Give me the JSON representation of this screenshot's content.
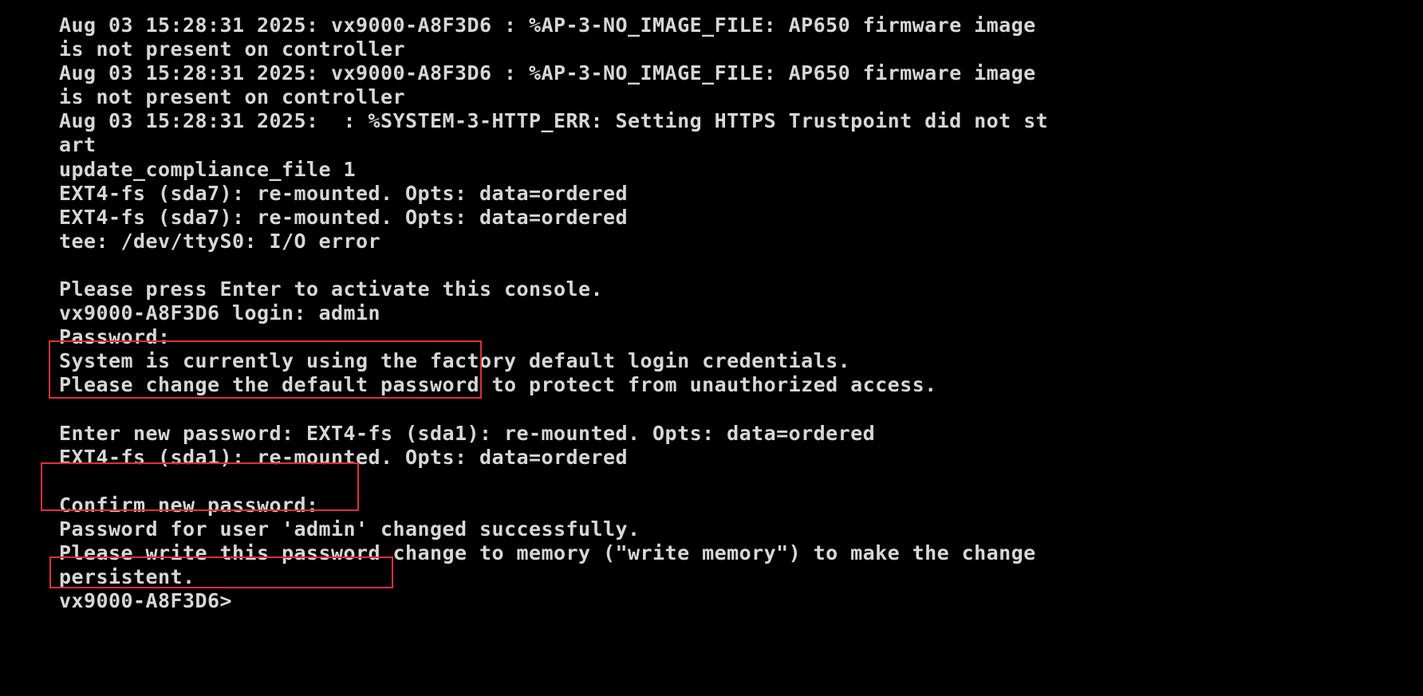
{
  "console": {
    "lines": [
      "Aug 03 15:28:31 2025: vx9000-A8F3D6 : %AP-3-NO_IMAGE_FILE: AP650 firmware image",
      "is not present on controller",
      "Aug 03 15:28:31 2025: vx9000-A8F3D6 : %AP-3-NO_IMAGE_FILE: AP650 firmware image",
      "is not present on controller",
      "Aug 03 15:28:31 2025:  : %SYSTEM-3-HTTP_ERR: Setting HTTPS Trustpoint did not st",
      "art",
      "update_compliance_file 1",
      "EXT4-fs (sda7): re-mounted. Opts: data=ordered",
      "EXT4-fs (sda7): re-mounted. Opts: data=ordered",
      "tee: /dev/ttyS0: I/O error",
      "",
      "Please press Enter to activate this console.",
      "vx9000-A8F3D6 login: admin",
      "Password:",
      "System is currently using the factory default login credentials.",
      "Please change the default password to protect from unauthorized access.",
      "",
      "Enter new password: EXT4-fs (sda1): re-mounted. Opts: data=ordered",
      "EXT4-fs (sda1): re-mounted. Opts: data=ordered",
      "",
      "Confirm new password:",
      "Password for user 'admin' changed successfully.",
      "Please write this password change to memory (\"write memory\") to make the change",
      "persistent.",
      "vx9000-A8F3D6>"
    ]
  },
  "highlight_color": "#e0303a",
  "text_color": "#d7d7d7",
  "background_color": "#000000"
}
